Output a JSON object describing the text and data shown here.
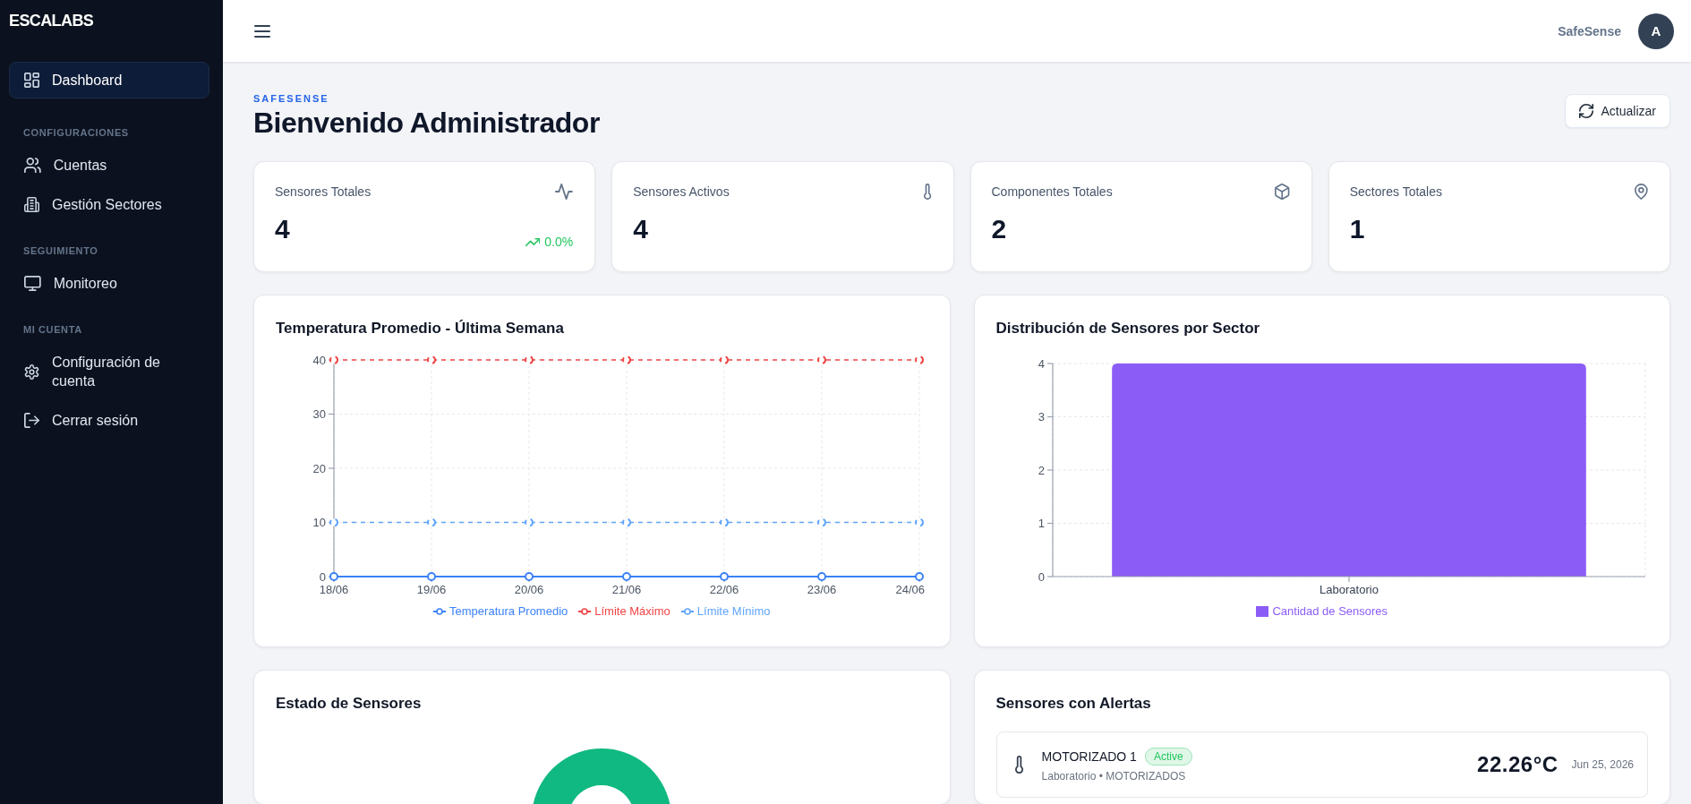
{
  "sidebar": {
    "logo": "ESCALABS",
    "sections": [
      {
        "items": [
          {
            "label": "Dashboard",
            "selected": true
          }
        ]
      },
      {
        "heading": "CONFIGURACIONES",
        "items": [
          {
            "label": "Cuentas",
            "selected": false
          },
          {
            "label": "Gestión Sectores",
            "selected": false
          }
        ]
      },
      {
        "heading": "SEGUIMIENTO",
        "items": [
          {
            "label": "Monitoreo",
            "selected": false
          }
        ]
      },
      {
        "heading": "MI CUENTA",
        "items": [
          {
            "label": "Configuración de cuenta",
            "selected": false
          },
          {
            "label": "Cerrar sesión",
            "selected": false
          }
        ]
      }
    ]
  },
  "header": {
    "brand": "SafeSense",
    "avatar": "A"
  },
  "page": {
    "eyebrow": "SAFESENSE",
    "title": "Bienvenido Administrador",
    "refresh_button": "Actualizar"
  },
  "stats": [
    {
      "label": "Sensores Totales",
      "value": "4",
      "trend": {
        "text": "0.0%",
        "rising": true
      }
    },
    {
      "label": "Sensores Activos",
      "value": "4"
    },
    {
      "label": "Componentes Totales",
      "value": "2"
    },
    {
      "label": "Sectores Totales",
      "value": "1"
    }
  ],
  "temperature_chart": {
    "chart_data": {
      "type": "line",
      "title": "Temperatura Promedio - Última Semana",
      "categories": [
        "18/06",
        "19/06",
        "20/06",
        "21/06",
        "22/06",
        "23/06",
        "24/06"
      ],
      "series": [
        {
          "name": "Temperatura Promedio",
          "color": "#3b82f6",
          "line_style": "solid",
          "marker": "circle",
          "values": [
            0,
            0,
            0,
            0,
            0,
            0,
            0
          ]
        },
        {
          "name": "Límite Máximo",
          "color": "#ef4444",
          "line_style": "dashed",
          "marker": "circle",
          "values": [
            40,
            40,
            40,
            40,
            40,
            40,
            40
          ]
        },
        {
          "name": "Límite Mínimo",
          "color": "#60a5fa",
          "line_style": "dashed",
          "marker": "circle",
          "values": [
            10,
            10,
            10,
            10,
            10,
            10,
            10
          ]
        }
      ],
      "ylim": [
        0,
        40
      ],
      "yticks": [
        0,
        10,
        20,
        30,
        40
      ],
      "grid": true
    }
  },
  "sector_chart": {
    "chart_data": {
      "type": "bar",
      "title": "Distribución de Sensores por Sector",
      "categories": [
        "Laboratorio"
      ],
      "series": [
        {
          "name": "Cantidad de Sensores",
          "color": "#8b5cf6",
          "values": [
            4
          ]
        }
      ],
      "ylim": [
        0,
        4
      ],
      "yticks": [
        0,
        1,
        2,
        3,
        4
      ],
      "grid": true
    }
  },
  "status_chart": {
    "title": "Estado de Sensores"
  },
  "alerts": {
    "title": "Sensores con Alertas",
    "items": [
      {
        "name": "MOTORIZADO 1",
        "badge": {
          "label": "Active",
          "color": "#22c55e"
        },
        "location": "Laboratorio • MOTORIZADOS",
        "reading": "22.26°C",
        "date": "Jun 25, 2026"
      }
    ]
  }
}
